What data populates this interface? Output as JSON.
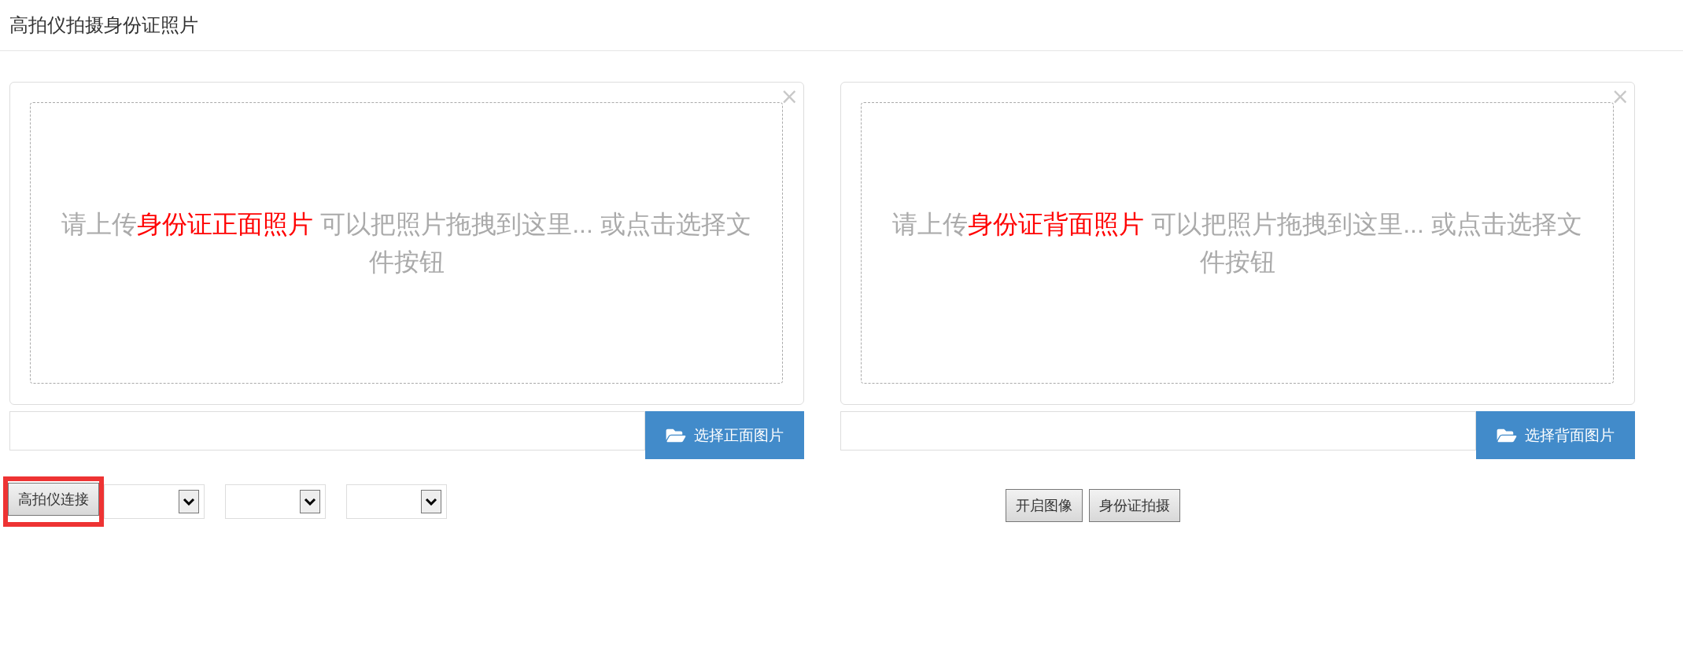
{
  "page_title": "高拍仪拍摄身份证照片",
  "uploads": [
    {
      "prompt_before": "请上传",
      "prompt_highlight": "身份证正面照片",
      "prompt_after": " 可以把照片拖拽到这里... 或点击选择文件按钮",
      "close": "×",
      "button": "选择正面图片"
    },
    {
      "prompt_before": "请上传",
      "prompt_highlight": "身份证背面照片",
      "prompt_after": " 可以把照片拖拽到这里... 或点击选择文件按钮",
      "close": "×",
      "button": "选择背面图片"
    }
  ],
  "connect_button": {
    "label": "高拍仪连接",
    "highlighted": true
  },
  "actions": [
    "开启图像",
    "身份证拍摄"
  ]
}
